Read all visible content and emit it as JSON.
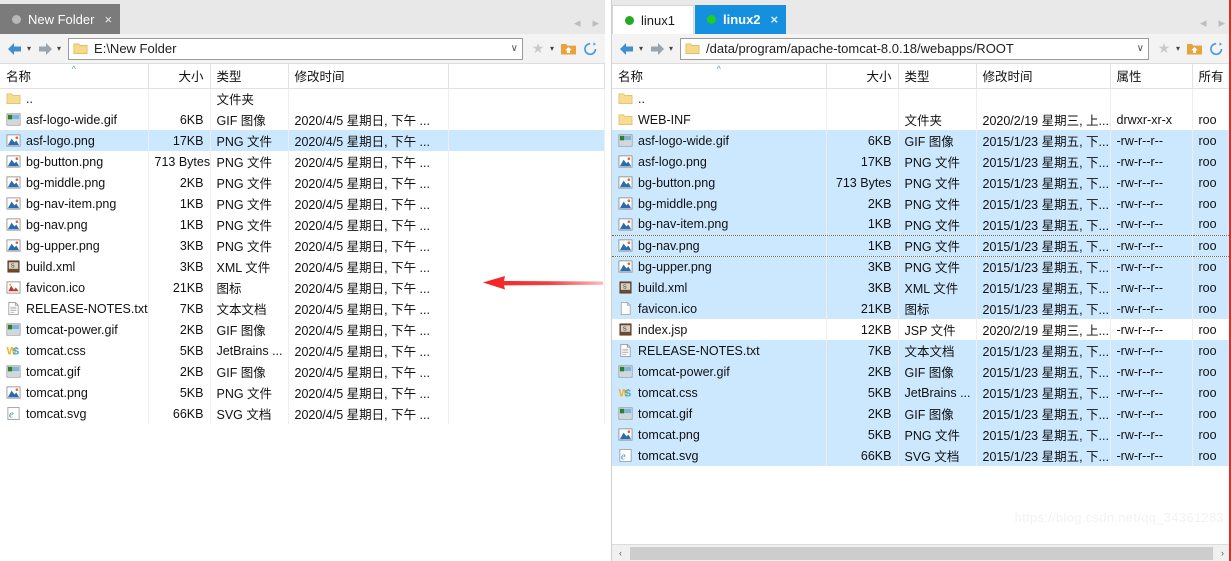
{
  "left_window": {
    "tab": {
      "label": "New Folder",
      "close": "×",
      "dot": "status-dot"
    },
    "tab_nav": {
      "prev": "◂",
      "next": "▸"
    },
    "address": {
      "value": "E:\\New Folder",
      "chevron": "∨"
    },
    "toolbar": {
      "back": "back-arrow",
      "back_caret": "▾",
      "forward": "forward-arrow",
      "forward_caret": "▾",
      "favorite": "★",
      "favorite_caret": "▾",
      "up_folder": "up-folder-icon",
      "refresh": "refresh-icon"
    },
    "columns": [
      "名称",
      "大小",
      "类型",
      "修改时间"
    ],
    "sort_indicator": "^",
    "rows": [
      {
        "icon": "folder",
        "name": "..",
        "size": "",
        "type": "文件夹",
        "mtime": "",
        "sel": false
      },
      {
        "icon": "gif",
        "name": "asf-logo-wide.gif",
        "size": "6KB",
        "type": "GIF 图像",
        "mtime": "2020/4/5 星期日, 下午 ...",
        "sel": false
      },
      {
        "icon": "png",
        "name": "asf-logo.png",
        "size": "17KB",
        "type": "PNG 文件",
        "mtime": "2020/4/5 星期日, 下午 ...",
        "sel": true
      },
      {
        "icon": "png",
        "name": "bg-button.png",
        "size": "713 Bytes",
        "type": "PNG 文件",
        "mtime": "2020/4/5 星期日, 下午 ...",
        "sel": false
      },
      {
        "icon": "png",
        "name": "bg-middle.png",
        "size": "2KB",
        "type": "PNG 文件",
        "mtime": "2020/4/5 星期日, 下午 ...",
        "sel": false
      },
      {
        "icon": "png",
        "name": "bg-nav-item.png",
        "size": "1KB",
        "type": "PNG 文件",
        "mtime": "2020/4/5 星期日, 下午 ...",
        "sel": false
      },
      {
        "icon": "png",
        "name": "bg-nav.png",
        "size": "1KB",
        "type": "PNG 文件",
        "mtime": "2020/4/5 星期日, 下午 ...",
        "sel": false
      },
      {
        "icon": "png",
        "name": "bg-upper.png",
        "size": "3KB",
        "type": "PNG 文件",
        "mtime": "2020/4/5 星期日, 下午 ...",
        "sel": false
      },
      {
        "icon": "xml",
        "name": "build.xml",
        "size": "3KB",
        "type": "XML 文件",
        "mtime": "2020/4/5 星期日, 下午 ...",
        "sel": false
      },
      {
        "icon": "ico",
        "name": "favicon.ico",
        "size": "21KB",
        "type": "图标",
        "mtime": "2020/4/5 星期日, 下午 ...",
        "sel": false
      },
      {
        "icon": "txt",
        "name": "RELEASE-NOTES.txt",
        "size": "7KB",
        "type": "文本文档",
        "mtime": "2020/4/5 星期日, 下午 ...",
        "sel": false
      },
      {
        "icon": "gif",
        "name": "tomcat-power.gif",
        "size": "2KB",
        "type": "GIF 图像",
        "mtime": "2020/4/5 星期日, 下午 ...",
        "sel": false
      },
      {
        "icon": "css",
        "name": "tomcat.css",
        "size": "5KB",
        "type": "JetBrains ...",
        "mtime": "2020/4/5 星期日, 下午 ...",
        "sel": false
      },
      {
        "icon": "gif",
        "name": "tomcat.gif",
        "size": "2KB",
        "type": "GIF 图像",
        "mtime": "2020/4/5 星期日, 下午 ...",
        "sel": false
      },
      {
        "icon": "png",
        "name": "tomcat.png",
        "size": "5KB",
        "type": "PNG 文件",
        "mtime": "2020/4/5 星期日, 下午 ...",
        "sel": false
      },
      {
        "icon": "svg",
        "name": "tomcat.svg",
        "size": "66KB",
        "type": "SVG 文档",
        "mtime": "2020/4/5 星期日, 下午 ...",
        "sel": false
      }
    ]
  },
  "right_window": {
    "tabs": [
      {
        "label": "linux1",
        "active": false,
        "close": ""
      },
      {
        "label": "linux2",
        "active": true,
        "close": "×"
      }
    ],
    "tab_nav": {
      "prev": "◂",
      "next": "▸"
    },
    "address": {
      "value": "/data/program/apache-tomcat-8.0.18/webapps/ROOT",
      "chevron": "∨"
    },
    "toolbar": {
      "back": "back-arrow",
      "back_caret": "▾",
      "forward": "forward-arrow",
      "forward_caret": "▾",
      "favorite": "★",
      "favorite_caret": "▾",
      "up_folder": "up-folder-icon",
      "refresh": "refresh-icon"
    },
    "columns": [
      "名称",
      "大小",
      "类型",
      "修改时间",
      "属性",
      "所有"
    ],
    "sort_indicator": "^",
    "rows": [
      {
        "icon": "folder",
        "name": "..",
        "size": "",
        "type": "",
        "mtime": "",
        "attr": "",
        "owner": "",
        "sel": false,
        "focus": false
      },
      {
        "icon": "folder",
        "name": "WEB-INF",
        "size": "",
        "type": "文件夹",
        "mtime": "2020/2/19 星期三, 上...",
        "attr": "drwxr-xr-x",
        "owner": "roo",
        "sel": false,
        "focus": false
      },
      {
        "icon": "gif",
        "name": "asf-logo-wide.gif",
        "size": "6KB",
        "type": "GIF 图像",
        "mtime": "2015/1/23 星期五, 下...",
        "attr": "-rw-r--r--",
        "owner": "roo",
        "sel": true,
        "focus": false
      },
      {
        "icon": "png",
        "name": "asf-logo.png",
        "size": "17KB",
        "type": "PNG 文件",
        "mtime": "2015/1/23 星期五, 下...",
        "attr": "-rw-r--r--",
        "owner": "roo",
        "sel": true,
        "focus": false
      },
      {
        "icon": "png",
        "name": "bg-button.png",
        "size": "713 Bytes",
        "type": "PNG 文件",
        "mtime": "2015/1/23 星期五, 下...",
        "attr": "-rw-r--r--",
        "owner": "roo",
        "sel": true,
        "focus": false
      },
      {
        "icon": "png",
        "name": "bg-middle.png",
        "size": "2KB",
        "type": "PNG 文件",
        "mtime": "2015/1/23 星期五, 下...",
        "attr": "-rw-r--r--",
        "owner": "roo",
        "sel": true,
        "focus": false
      },
      {
        "icon": "png",
        "name": "bg-nav-item.png",
        "size": "1KB",
        "type": "PNG 文件",
        "mtime": "2015/1/23 星期五, 下...",
        "attr": "-rw-r--r--",
        "owner": "roo",
        "sel": true,
        "focus": false
      },
      {
        "icon": "png",
        "name": "bg-nav.png",
        "size": "1KB",
        "type": "PNG 文件",
        "mtime": "2015/1/23 星期五, 下...",
        "attr": "-rw-r--r--",
        "owner": "roo",
        "sel": true,
        "focus": true
      },
      {
        "icon": "png",
        "name": "bg-upper.png",
        "size": "3KB",
        "type": "PNG 文件",
        "mtime": "2015/1/23 星期五, 下...",
        "attr": "-rw-r--r--",
        "owner": "roo",
        "sel": true,
        "focus": false
      },
      {
        "icon": "xml",
        "name": "build.xml",
        "size": "3KB",
        "type": "XML 文件",
        "mtime": "2015/1/23 星期五, 下...",
        "attr": "-rw-r--r--",
        "owner": "roo",
        "sel": true,
        "focus": false
      },
      {
        "icon": "blank",
        "name": "favicon.ico",
        "size": "21KB",
        "type": "图标",
        "mtime": "2015/1/23 星期五, 下...",
        "attr": "-rw-r--r--",
        "owner": "roo",
        "sel": true,
        "focus": false
      },
      {
        "icon": "xml",
        "name": "index.jsp",
        "size": "12KB",
        "type": "JSP 文件",
        "mtime": "2020/2/19 星期三, 上...",
        "attr": "-rw-r--r--",
        "owner": "roo",
        "sel": false,
        "focus": false
      },
      {
        "icon": "txt",
        "name": "RELEASE-NOTES.txt",
        "size": "7KB",
        "type": "文本文档",
        "mtime": "2015/1/23 星期五, 下...",
        "attr": "-rw-r--r--",
        "owner": "roo",
        "sel": true,
        "focus": false
      },
      {
        "icon": "gif",
        "name": "tomcat-power.gif",
        "size": "2KB",
        "type": "GIF 图像",
        "mtime": "2015/1/23 星期五, 下...",
        "attr": "-rw-r--r--",
        "owner": "roo",
        "sel": true,
        "focus": false
      },
      {
        "icon": "css",
        "name": "tomcat.css",
        "size": "5KB",
        "type": "JetBrains ...",
        "mtime": "2015/1/23 星期五, 下...",
        "attr": "-rw-r--r--",
        "owner": "roo",
        "sel": true,
        "focus": false
      },
      {
        "icon": "gif",
        "name": "tomcat.gif",
        "size": "2KB",
        "type": "GIF 图像",
        "mtime": "2015/1/23 星期五, 下...",
        "attr": "-rw-r--r--",
        "owner": "roo",
        "sel": true,
        "focus": false
      },
      {
        "icon": "png",
        "name": "tomcat.png",
        "size": "5KB",
        "type": "PNG 文件",
        "mtime": "2015/1/23 星期五, 下...",
        "attr": "-rw-r--r--",
        "owner": "roo",
        "sel": true,
        "focus": false
      },
      {
        "icon": "svg",
        "name": "tomcat.svg",
        "size": "66KB",
        "type": "SVG 文档",
        "mtime": "2015/1/23 星期五, 下...",
        "attr": "-rw-r--r--",
        "owner": "roo",
        "sel": true,
        "focus": false
      }
    ],
    "scrollbar": {
      "left": "‹",
      "right": "›"
    }
  },
  "annotation": {
    "arrow": "red-left-arrow"
  },
  "watermark": "https://blog.csdn.net/qq_34361283",
  "colors": {
    "tab_active": "#1490df",
    "selection": "#cce8ff",
    "arrow": "#f32222",
    "accent_orange": "#e8a33d"
  }
}
